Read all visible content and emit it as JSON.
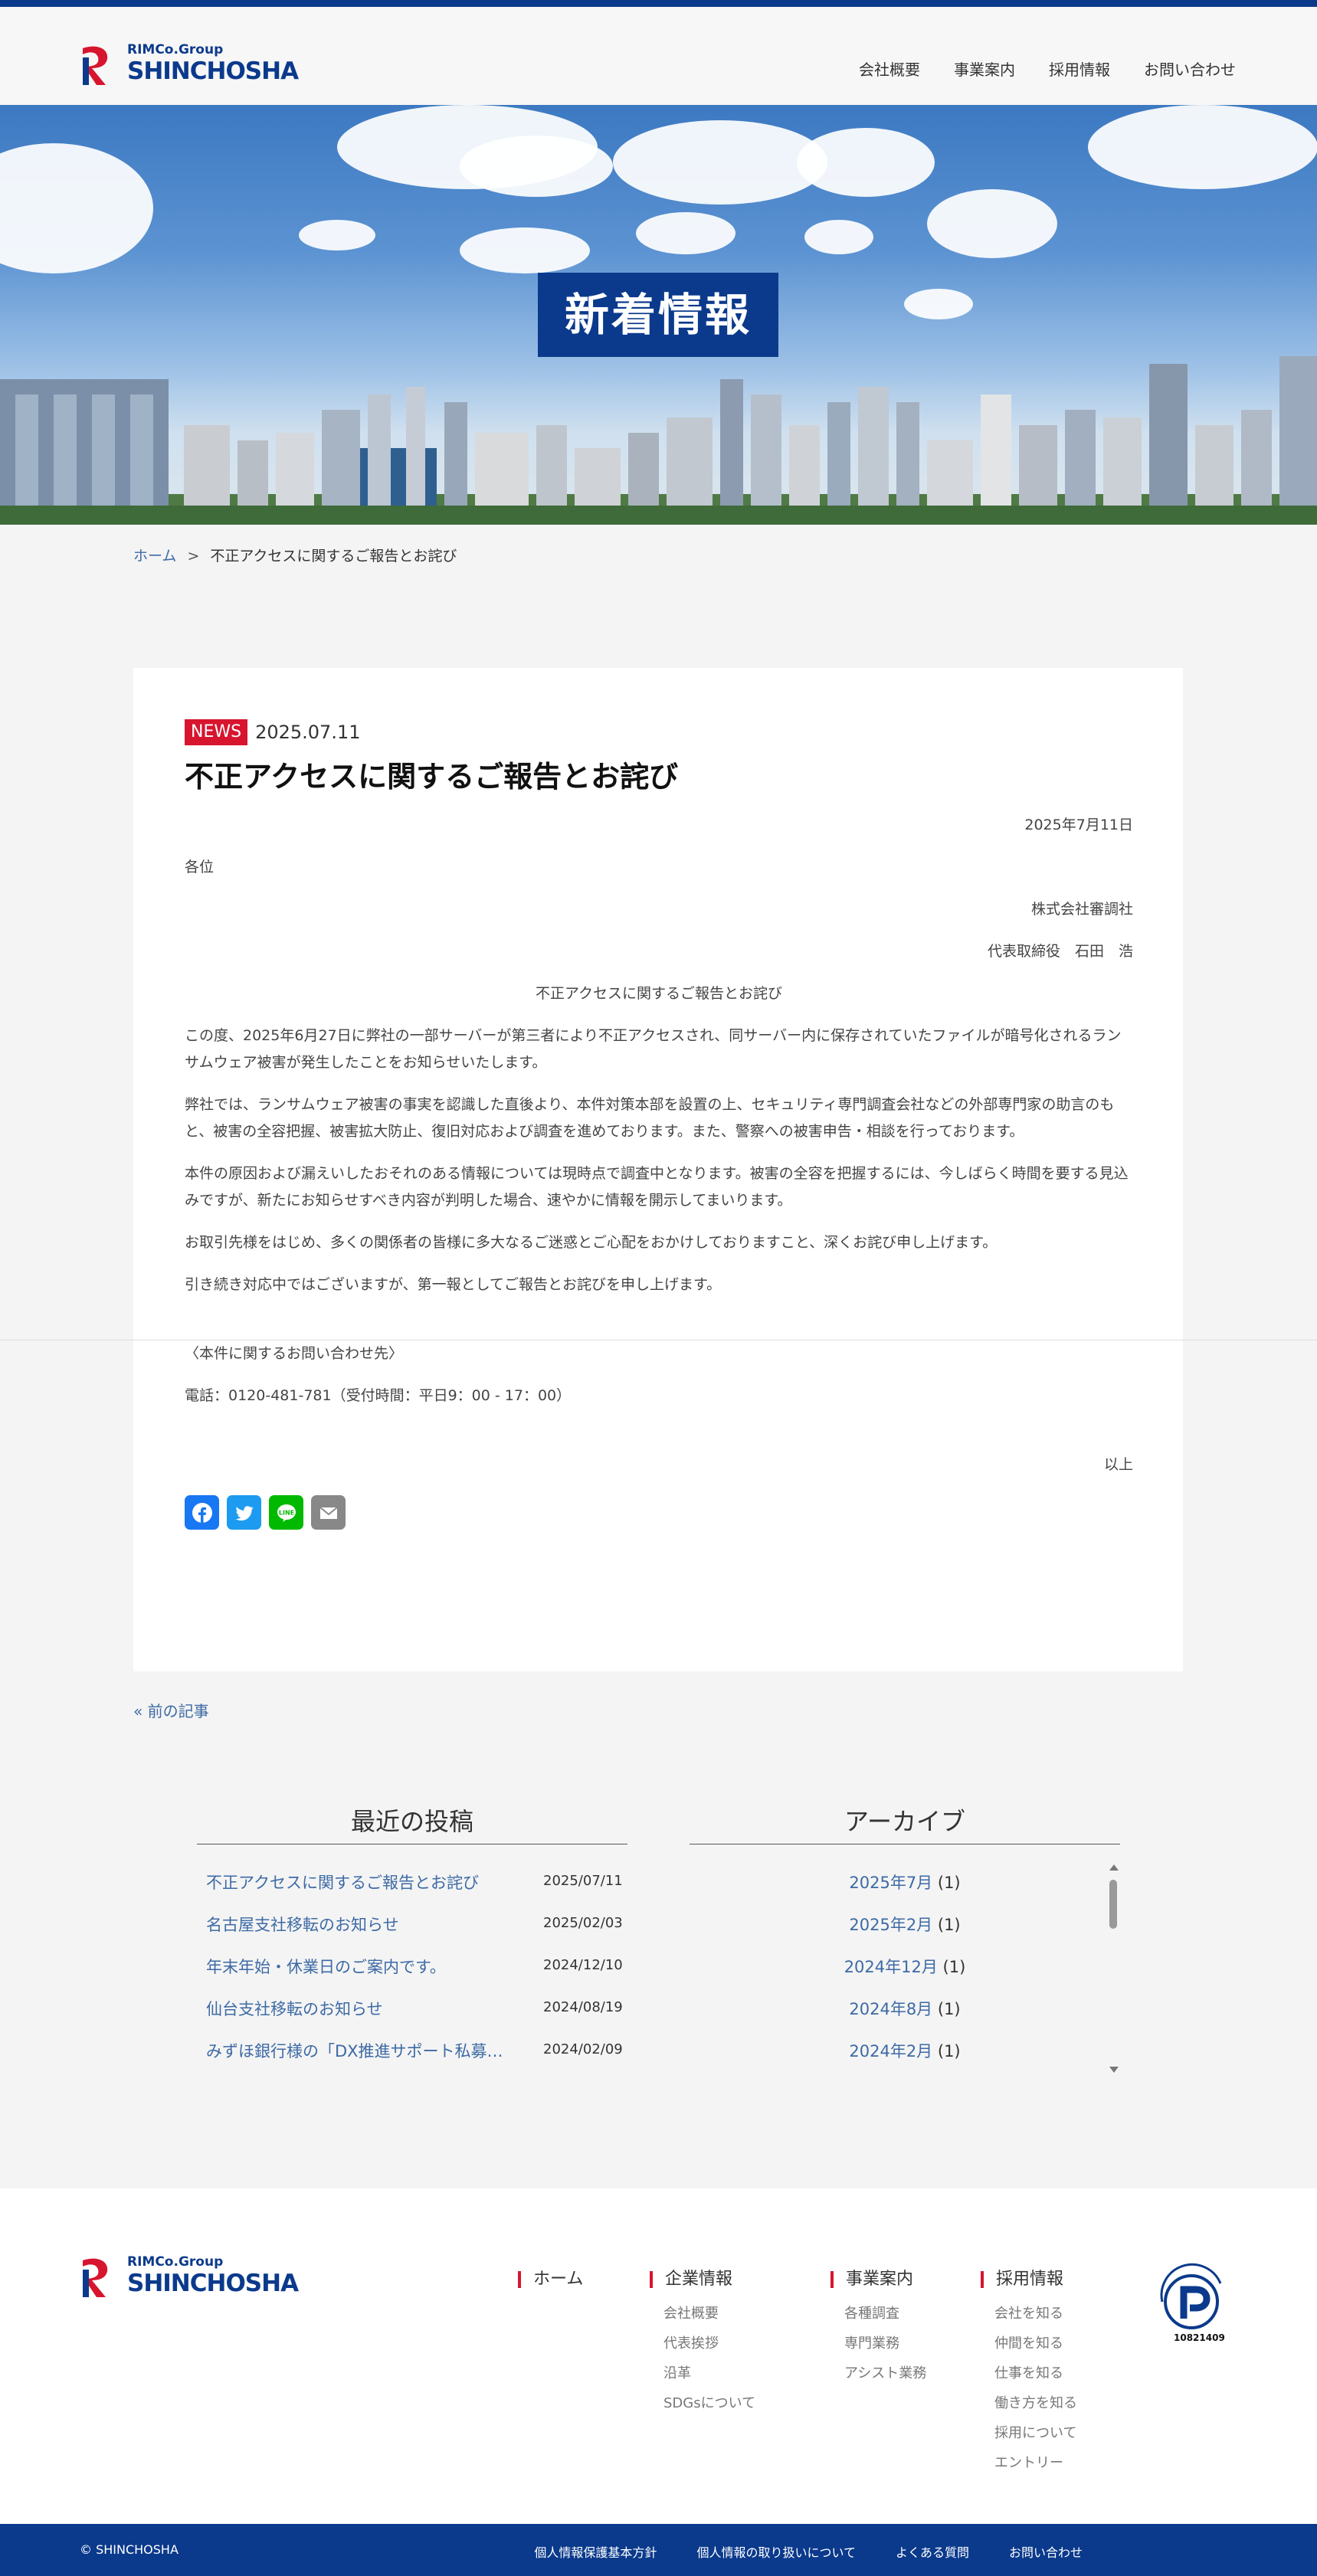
{
  "brand": {
    "group": "RIMCo.Group",
    "name": "SHINCHOSHA",
    "color": "#0b3a8c",
    "accent": "#d7152e"
  },
  "nav": [
    "会社概要",
    "事業案内",
    "採用情報",
    "お問い合わせ"
  ],
  "hero": {
    "title": "新着情報"
  },
  "breadcrumb": {
    "home": "ホーム",
    "separator": ">",
    "current": "不正アクセスに関するご報告とお詫び"
  },
  "article": {
    "badge": "NEWS",
    "date": "2025.07.11",
    "title": "不正アクセスに関するご報告とお詫び",
    "doc_date": "2025年7月11日",
    "addressee": "各位",
    "company": "株式会社審調社",
    "representative": "代表取締役　石田　浩",
    "subject": "不正アクセスに関するご報告とお詫び",
    "paragraphs": [
      "この度、2025年6月27日に弊社の一部サーバーが第三者により不正アクセスされ、同サーバー内に保存されていたファイルが暗号化されるランサムウェア被害が発生したことをお知らせいたします。",
      "弊社では、ランサムウェア被害の事実を認識した直後より、本件対策本部を設置の上、セキュリティ専門調査会社などの外部専門家の助言のもと、被害の全容把握、被害拡大防止、復旧対応および調査を進めております。また、警察への被害申告・相談を行っております。",
      "本件の原因および漏えいしたおそれのある情報については現時点で調査中となります。被害の全容を把握するには、今しばらく時間を要する見込みですが、新たにお知らせすべき内容が判明した場合、速やかに情報を開示してまいります。",
      "お取引先様をはじめ、多くの関係者の皆様に多大なるご迷惑とご心配をおかけしておりますこと、深くお詫び申し上げます。",
      "引き続き対応中ではございますが、第一報としてご報告とお詫びを申し上げます。"
    ],
    "contact_heading": "〈本件に関するお問い合わせ先〉",
    "contact_phone": "電話：0120-481-781（受付時間：平日9：00 - 17：00）",
    "closing": "以上",
    "share": [
      {
        "icon": "facebook-icon",
        "color": "#1877f2"
      },
      {
        "icon": "twitter-icon",
        "color": "#1d9bf0"
      },
      {
        "icon": "line-icon",
        "color": "#00b900"
      },
      {
        "icon": "email-icon",
        "color": "#888888"
      }
    ]
  },
  "prev_link": "« 前の記事",
  "recent": {
    "heading": "最近の投稿",
    "items": [
      {
        "title": "不正アクセスに関するご報告とお詫び",
        "date": "2025/07/11"
      },
      {
        "title": "名古屋支社移転のお知らせ",
        "date": "2025/02/03"
      },
      {
        "title": "年末年始・休業日のご案内です。",
        "date": "2024/12/10"
      },
      {
        "title": "仙台支社移転のお知らせ",
        "date": "2024/08/19"
      },
      {
        "title": "みずほ銀行様の「DX推進サポート私募…",
        "date": "2024/02/09"
      }
    ]
  },
  "archive": {
    "heading": "アーカイブ",
    "items": [
      {
        "month": "2025年7月",
        "count": "(1)"
      },
      {
        "month": "2025年2月",
        "count": "(1)"
      },
      {
        "month": "2024年12月",
        "count": "(1)"
      },
      {
        "month": "2024年8月",
        "count": "(1)"
      },
      {
        "month": "2024年2月",
        "count": "(1)"
      }
    ]
  },
  "footer": {
    "columns": [
      {
        "heading": "ホーム",
        "items": []
      },
      {
        "heading": "企業情報",
        "items": [
          "会社概要",
          "代表挨拶",
          "沿革",
          "SDGsについて"
        ]
      },
      {
        "heading": "事業案内",
        "items": [
          "各種調査",
          "専門業務",
          "アシスト業務"
        ]
      },
      {
        "heading": "採用情報",
        "items": [
          "会社を知る",
          "仲間を知る",
          "仕事を知る",
          "働き方を知る",
          "採用について",
          "エントリー"
        ]
      }
    ],
    "pmark": {
      "text_top": "たいせつにしますプライバシー",
      "number": "10821409"
    },
    "copyright": "© SHINCHOSHA",
    "bottom_links": [
      "個人情報保護基本方針",
      "個人情報の取り扱いについて",
      "よくある質問",
      "お問い合わせ"
    ]
  }
}
